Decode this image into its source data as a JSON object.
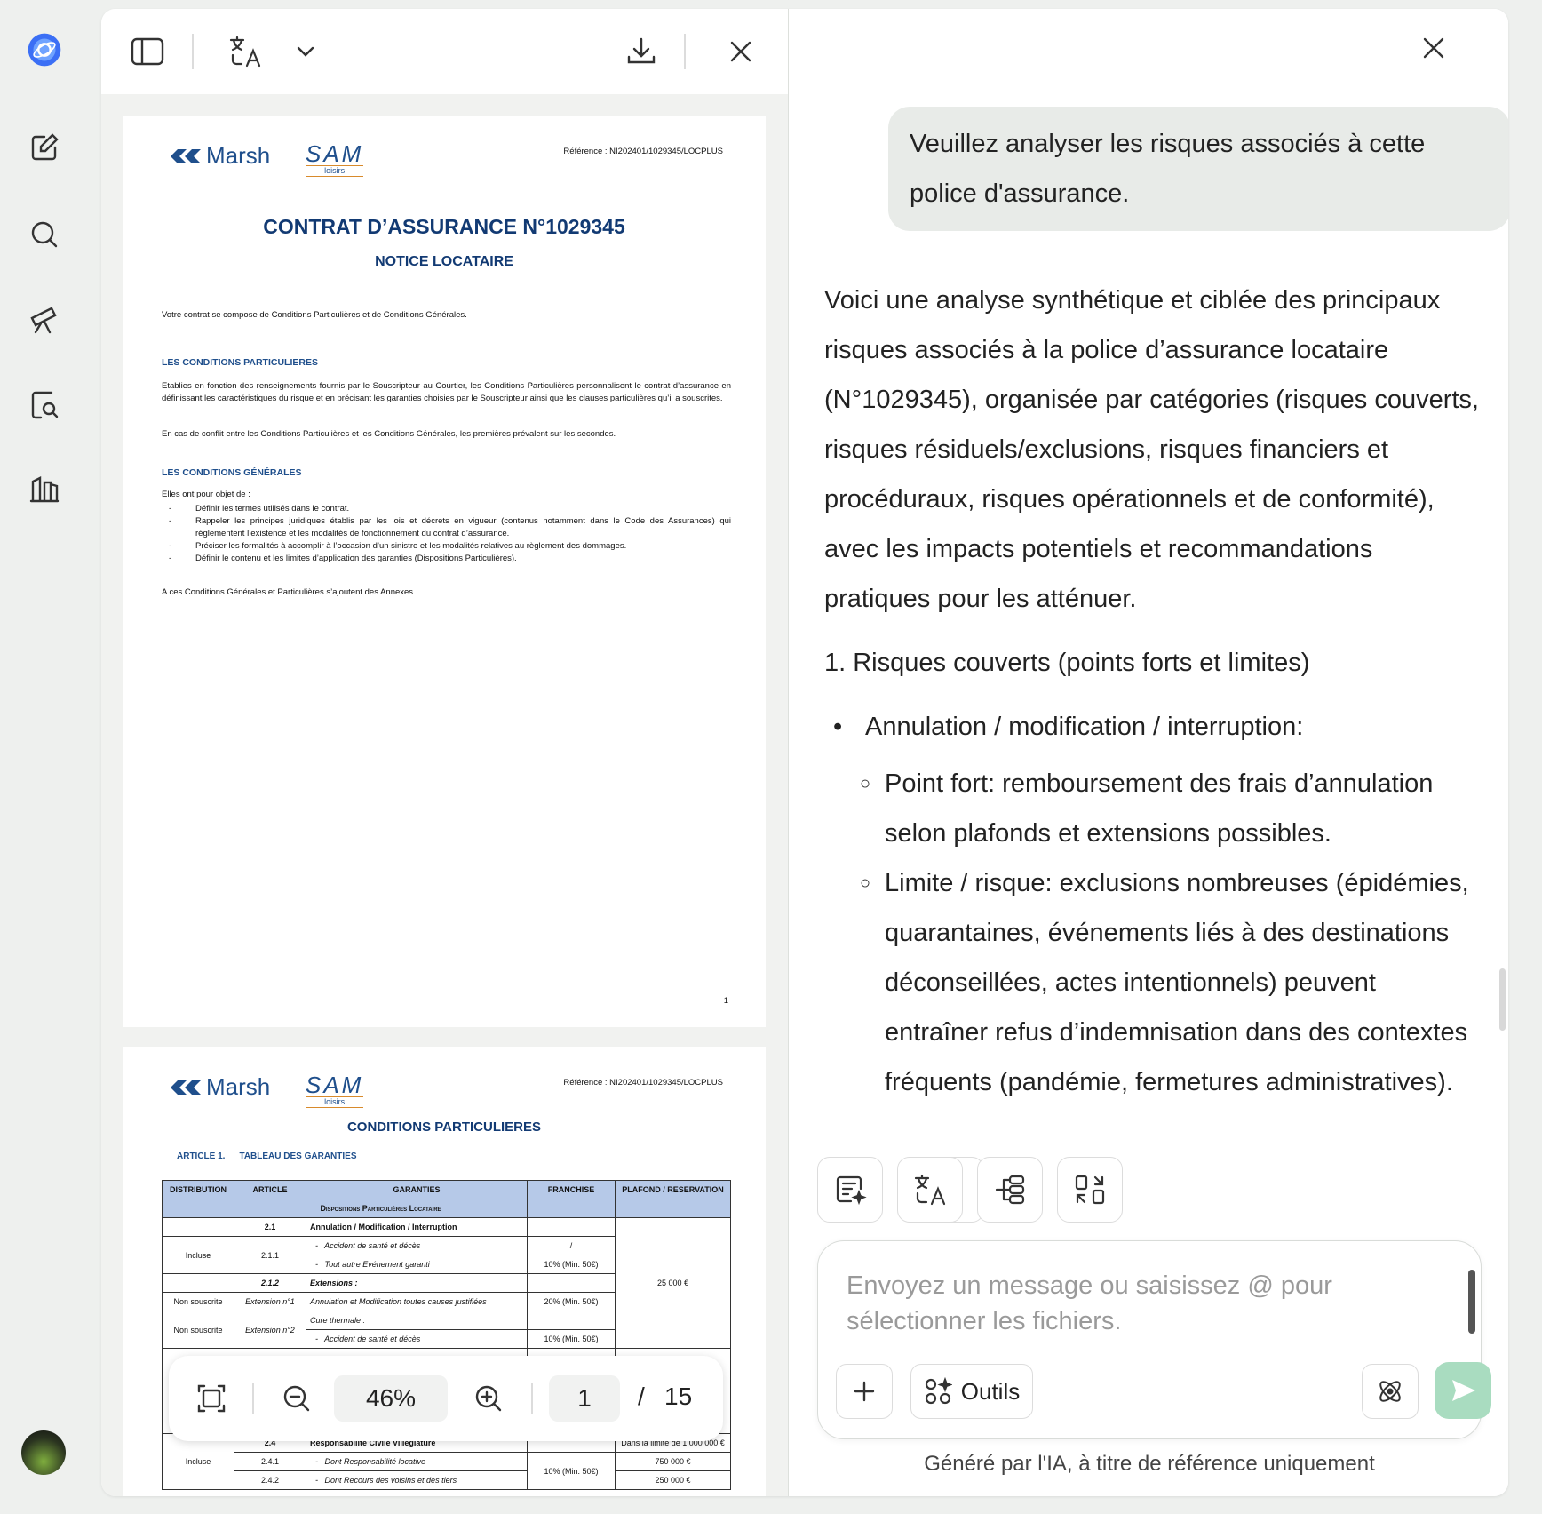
{
  "rail": {
    "items": [
      "app-logo",
      "new-chat",
      "search",
      "explore",
      "document-search",
      "library"
    ]
  },
  "toolbar": {
    "download_label": "download",
    "close_label": "close"
  },
  "page1": {
    "brand": "Marsh",
    "partner": "SAM",
    "partner_sub": "loisirs",
    "reference": "Référence : NI202401/1029345/LOCPLUS",
    "title": "CONTRAT D’ASSURANCE N°1029345",
    "subtitle": "NOTICE LOCATAIRE",
    "intro": "Votre contrat se compose de Conditions Particulières et de Conditions Générales.",
    "sec1_title": "LES CONDITIONS PARTICULIERES",
    "sec1_p1": "Etablies en fonction des renseignements fournis par le Souscripteur au Courtier, les Conditions Particulières personnalisent le contrat d’assurance en définissant les caractéristiques du risque et en précisant les garanties choisies par le Souscripteur ainsi que les clauses particulières qu’il a souscrites.",
    "sec1_p2": "En cas de conflit entre les Conditions Particulières et les Conditions Générales, les premières prévalent sur les secondes.",
    "sec2_title": "LES CONDITIONS GÉNÉRALES",
    "sec2_intro": "Elles ont pour objet de :",
    "sec2_items": [
      "Définir les termes utilisés dans le contrat.",
      "Rappeler les principes juridiques établis par les lois et décrets en vigueur (contenus notamment dans le Code des Assurances) qui réglementent l’existence et les modalités de fonctionnement du contrat d’assurance.",
      "Préciser les formalités à accomplir à l’occasion d’un sinistre et les modalités relatives au règlement des dommages.",
      "Définir le contenu et les limites d’application des garanties (Dispositions Particulières)."
    ],
    "sec2_outro": "A ces Conditions Générales et Particulières s’ajoutent des Annexes.",
    "page_number": "1"
  },
  "page2": {
    "brand": "Marsh",
    "partner": "SAM",
    "partner_sub": "loisirs",
    "reference": "Référence : NI202401/1029345/LOCPLUS",
    "title": "CONDITIONS PARTICULIERES",
    "article": "ARTICLE 1.",
    "article_title": "TABLEAU DES GARANTIES",
    "headers": [
      "DISTRIBUTION",
      "ARTICLE",
      "GARANTIES",
      "FRANCHISE",
      "PLAFOND / RESERVATION"
    ],
    "band": "Dispositions Particulières Locataire",
    "rows": {
      "r1_article": "2.1",
      "r1_garantie": "Annulation / Modification / Interruption",
      "r2_dist": "Incluse",
      "r2_article": "2.1.1",
      "r2a_garantie": "Accident de santé et décès",
      "r2a_franchise": "/",
      "r2b_garantie": "Tout autre Evénement garanti",
      "r2b_franchise": "10% (Min. 50€)",
      "plafond_1": "25 000 €",
      "r3_article": "2.1.2",
      "r3_garantie": "Extensions :",
      "r4_dist": "Non souscrite",
      "r4_article": "Extension n°1",
      "r4_garantie": "Annulation et Modification toutes causes justifiées",
      "r4_franchise": "20% (Min. 50€)",
      "r5_garantie": "Cure thermale :",
      "r6_dist": "Non souscrite",
      "r6_article": "Extension n°2",
      "r6_garantie": "Accident de santé et décès",
      "r6_franchise": "10% (Min. 50€)",
      "r7_article": "2.4",
      "r7_garantie": "Responsabilité Civile Villégiature",
      "r7_plafond": "Dans la limite de 1 000 000 €",
      "r8_dist": "Incluse",
      "r8_article": "2.4.1",
      "r8_garantie": "Dont Responsabilité locative",
      "r8_franchise": "10% (Min. 50€)",
      "r8_plafond": "750 000 €",
      "r9_article": "2.4.2",
      "r9_garantie": "Dont Recours des voisins et des tiers",
      "r9_plafond": "250 000 €"
    }
  },
  "zoom": {
    "value": "46%",
    "page": "1",
    "separator": "/",
    "total": "15"
  },
  "chat": {
    "user_message": "Veuillez analyser les risques associés à cette police d'assurance.",
    "intro": "Voici une analyse synthétique et ciblée des principaux risques associés à la police d’assurance locataire (N°1029345), organisée par catégories (risques couverts, risques résiduels/exclusions, risques financiers et procéduraux, risques opérationnels et de conformité), avec les impacts potentiels et recommandations pratiques pour les atténuer.",
    "heading1": "1. Risques couverts (points forts et limites)",
    "bullet1": "Annulation / modification / interruption:",
    "sub1": "Point fort: remboursement des frais d’annulation selon plafonds et extensions possibles.",
    "sub2": "Limite / risque: exclusions nombreuses (épidémies, quarantaines, événements liés à des destinations déconseillées, actes intentionnels) peuvent entraîner refus d’indemnisation dans des contextes fréquents (pandémie, fermetures administratives).",
    "input_placeholder": "Envoyez un message ou saisissez @ pour sélectionner les fichiers.",
    "tools_label": "Outils",
    "disclaimer": "Généré par l'IA, à titre de référence uniquement"
  }
}
